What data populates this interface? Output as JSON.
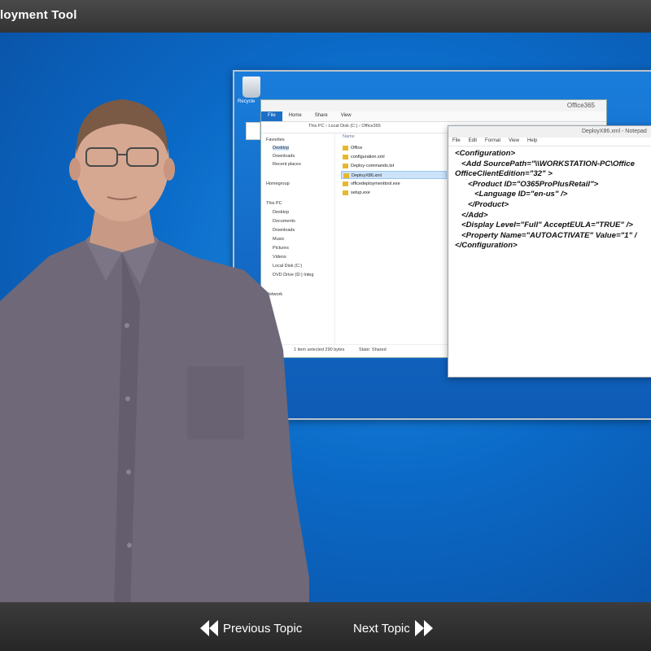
{
  "header": {
    "title": "loyment Tool"
  },
  "footer": {
    "previous_label": "Previous Topic",
    "next_label": "Next Topic"
  },
  "desktop": {
    "recycle_label": "Recycle"
  },
  "explorer": {
    "title": "Office365",
    "ribbon": [
      "File",
      "Home",
      "Share",
      "View"
    ],
    "breadcrumb": "This PC  ›  Local Disk (C:)  ›  Office365",
    "column_header": "Name",
    "nav_items": [
      "Favorites",
      "Desktop",
      "Downloads",
      "Recent places",
      "Homegroup",
      "This PC",
      "Desktop",
      "Documents",
      "Downloads",
      "Music",
      "Pictures",
      "Videos",
      "Local Disk (C:)",
      "DVD Drive (D:) Integ",
      "Network"
    ],
    "files": [
      "Office",
      "configuration.xml",
      "Deploy-commands.txt",
      "DeployX86.xml",
      "officedeploymenttool.exe",
      "setup.exe"
    ],
    "status_left": "1 item selected  290 bytes",
    "status_right": "State: Shared"
  },
  "notepad": {
    "title": "DeployX86.xml - Notepad",
    "menu": [
      "File",
      "Edit",
      "Format",
      "View",
      "Help"
    ],
    "content": "<Configuration>\n   <Add SourcePath=\"\\\\WORKSTATION-PC\\Office\nOfficeClientEdition=\"32\" >\n      <Product ID=\"O365ProPlusRetail\">\n         <Language ID=\"en-us\" />\n      </Product>\n   </Add>\n   <Display Level=\"Full\" AcceptEULA=\"TRUE\" />\n   <Property Name=\"AUTOACTIVATE\" Value=\"1\" /\n</Configuration>"
  }
}
